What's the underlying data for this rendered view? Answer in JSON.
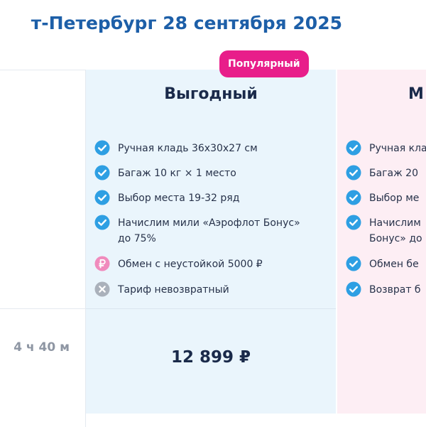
{
  "title": "т-Петербург 28 сентября 2025",
  "flight": {
    "duration": "4 ч 40 м"
  },
  "tariff_main": {
    "badge": "Популярный",
    "name": "Выгодный",
    "features": [
      {
        "icon": "check-icon",
        "text": "Ручная кладь 36x30x27 см"
      },
      {
        "icon": "check-icon",
        "text": "Багаж 10 кг × 1 место"
      },
      {
        "icon": "check-icon",
        "text": "Выбор места 19-32 ряд"
      },
      {
        "icon": "check-icon",
        "text": "Начислим мили «Аэрофлот Бонус» до 75%"
      },
      {
        "icon": "ruble-icon",
        "text": "Обмен с неустойкой 5000 ₽"
      },
      {
        "icon": "cross-icon",
        "text": "Тариф невозвратный"
      }
    ],
    "price": "12 899 ₽"
  },
  "tariff_next": {
    "name": "М",
    "features": [
      {
        "icon": "check-icon",
        "text": "Ручная кла"
      },
      {
        "icon": "check-icon",
        "text": "Багаж 20"
      },
      {
        "icon": "check-icon",
        "text": "Выбор ме"
      },
      {
        "icon": "check-icon",
        "text": "Начислим"
      },
      {
        "icon": "check-icon",
        "text": "Бонус» до"
      },
      {
        "icon": "check-icon",
        "text": "Обмен бе"
      },
      {
        "icon": "check-icon",
        "text": "Возврат б"
      }
    ]
  },
  "colors": {
    "accent": "#1d5fa8",
    "check": "#2e9fe3",
    "ruble": "#f08bbd",
    "cross": "#aab1bb",
    "badge": "#e81e8a",
    "tariff_main_bg": "#eaf5fc",
    "tariff_next_bg": "#fdeef4"
  }
}
